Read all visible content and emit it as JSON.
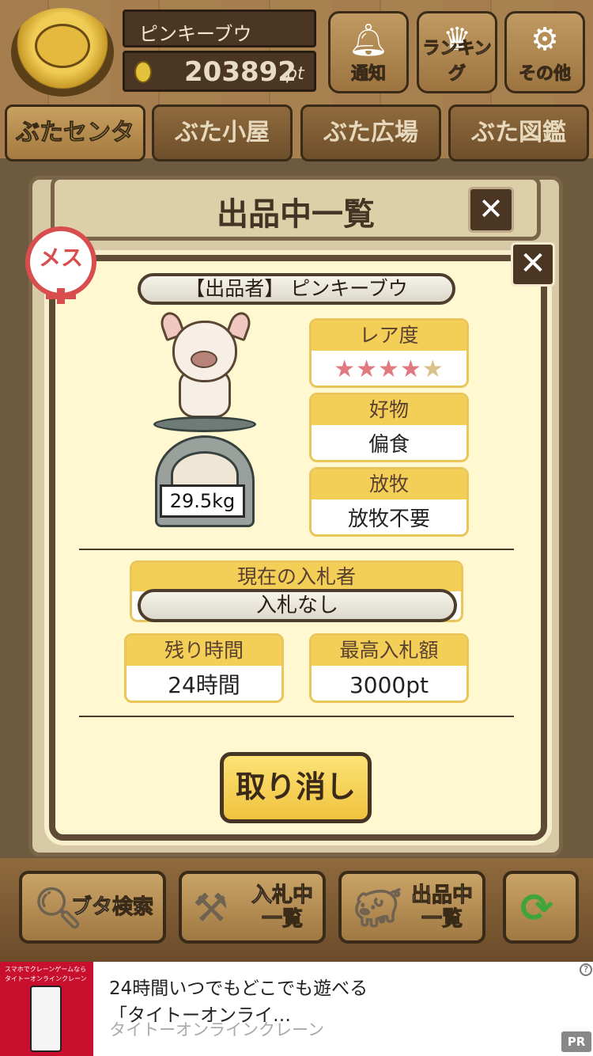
{
  "header": {
    "user_name": "ピンキーブウ",
    "points_value": "203892",
    "points_unit": "pt",
    "buttons": [
      {
        "label": "通知",
        "icon": "bell-icon"
      },
      {
        "label": "ランキング",
        "icon": "crown-icon"
      },
      {
        "label": "その他",
        "icon": "gear-icon"
      }
    ]
  },
  "tabs": [
    {
      "label": "ぶたセンター",
      "active": true
    },
    {
      "label": "ぶた小屋"
    },
    {
      "label": "ぶた広場"
    },
    {
      "label": "ぶた図鑑"
    }
  ],
  "panel": {
    "title": "出品中一覧",
    "close_glyph": "✕"
  },
  "card": {
    "gender_label": "メス",
    "seller": "【出品者】 ピンキーブウ",
    "weight": "29.5kg",
    "rarity": {
      "label": "レア度",
      "stars": 4,
      "max_stars": 5
    },
    "favorite": {
      "label": "好物",
      "value": "偏食"
    },
    "grazing": {
      "label": "放牧",
      "value": "放牧不要"
    },
    "current_bidder": {
      "label": "現在の入札者",
      "value": "入札なし"
    },
    "remaining_time": {
      "label": "残り時間",
      "value": "24時間"
    },
    "max_bid": {
      "label": "最高入札額",
      "value": "3000pt"
    },
    "cancel_label": "取り消し"
  },
  "bottom_nav": [
    {
      "label": "ブタ検索",
      "icon": "magnifier-icon"
    },
    {
      "label": "入札中\n一覧",
      "icon": "gavel-icon"
    },
    {
      "label": "出品中\n一覧",
      "icon": "pig-icon"
    },
    {
      "label": "",
      "icon": "refresh-icon"
    }
  ],
  "ad": {
    "image_caption": "スマホでクレーンゲームなら タイトーオンラインクレーン",
    "headline": "24時間いつでもどこでも遊べる",
    "subline": "「タイトーオンライ…",
    "advertiser": "タイトーオンラインクレーン",
    "info_glyph": "?",
    "pr_label": "PR"
  },
  "colors": {
    "accent_yellow": "#f3cf58",
    "star_on": "#e07a80",
    "female_red": "#d84d4e",
    "wood_dark": "#4b3623"
  }
}
